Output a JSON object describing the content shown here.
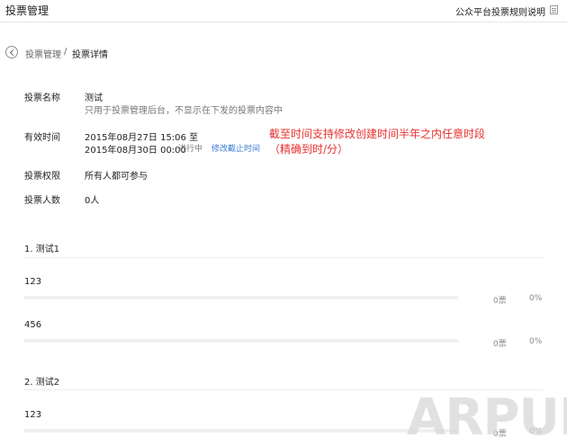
{
  "header": {
    "title": "投票管理",
    "help_link": "公众平台投票规则说明"
  },
  "breadcrumb": {
    "parent": "投票管理",
    "separator": "/",
    "current": "投票详情"
  },
  "vote": {
    "name_label": "投票名称",
    "name_value": "测试",
    "name_note": "只用于投票管理后台，不显示在下发的投票内容中",
    "time_label": "有效时间",
    "time_start": "2015年08月27日 15:06 至",
    "time_end": "2015年08月30日 00:00",
    "status": "进行中",
    "edit_deadline": "修改截止时间",
    "permission_label": "投票权限",
    "permission_value": "所有人都可参与",
    "count_label": "投票人数",
    "count_value": "0人"
  },
  "annotation": {
    "line1": "截至时间支持修改创建时间半年之内任意时段",
    "line2": "（精确到时/分）"
  },
  "questions": [
    {
      "title": "1. 测试1",
      "options": [
        {
          "label": "123",
          "votes": "0票",
          "percent": "0%",
          "fill": 0
        },
        {
          "label": "456",
          "votes": "0票",
          "percent": "0%",
          "fill": 0
        }
      ]
    },
    {
      "title": "2. 测试2",
      "options": [
        {
          "label": "123",
          "votes": "0票",
          "percent": "0%",
          "fill": 0
        }
      ]
    }
  ],
  "watermark": "ARPUN.COM",
  "colors": {
    "accent_link": "#3b7bd3",
    "annotation_red": "#e8312f",
    "bar_fill": "#44b549"
  },
  "icons": {
    "back": "back-arrow-circle-icon",
    "help_doc": "document-icon"
  }
}
